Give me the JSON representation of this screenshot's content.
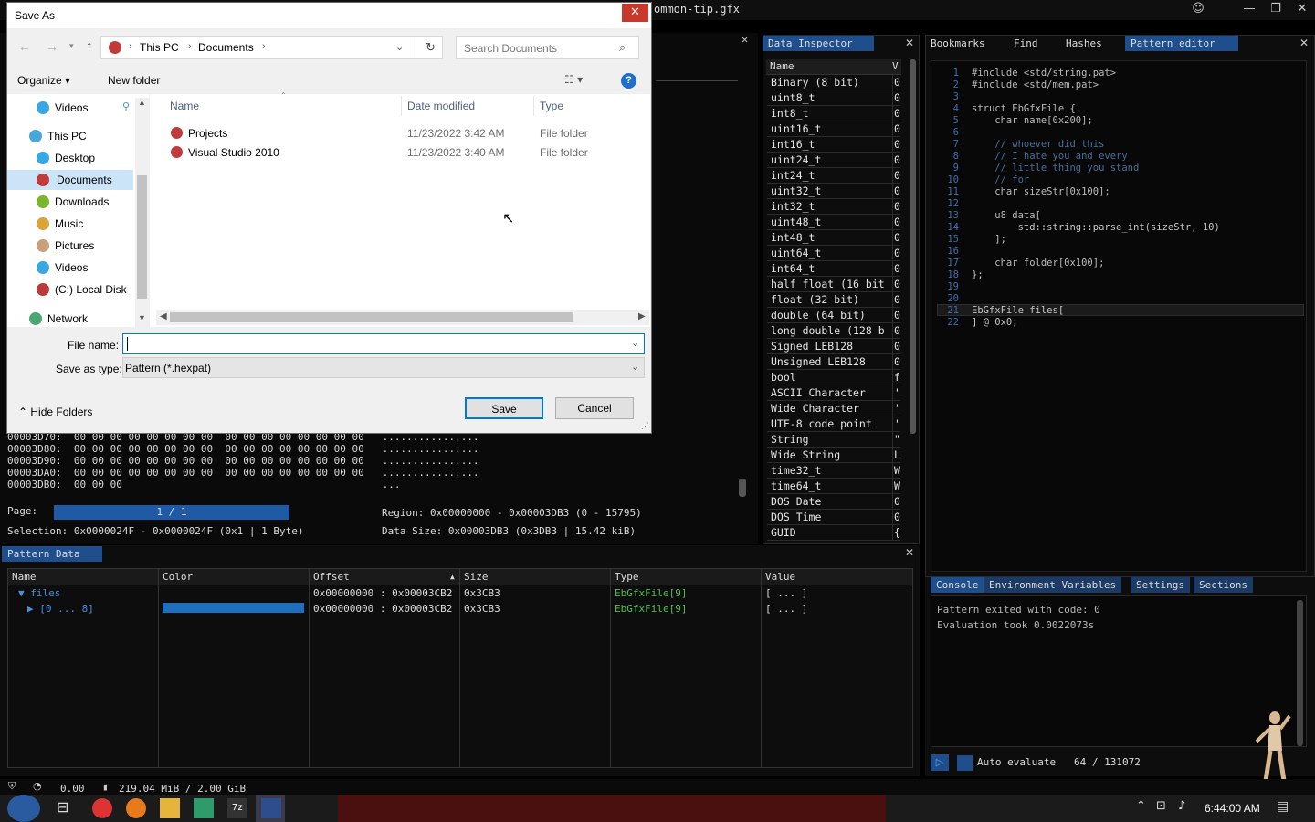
{
  "app": {
    "window_title": "ommon-tip.gfx",
    "colors": {
      "accent": "#1f4e8c",
      "bg": "#0d0d0d",
      "highlight_blue": "#2266c0"
    }
  },
  "data_inspector": {
    "tab": "Data Inspector",
    "col_name": "Name",
    "col_value": "V",
    "rows": [
      {
        "name": "Binary (8 bit)",
        "value": "0"
      },
      {
        "name": "uint8_t",
        "value": "0"
      },
      {
        "name": "int8_t",
        "value": "0"
      },
      {
        "name": "uint16_t",
        "value": "0"
      },
      {
        "name": "int16_t",
        "value": "0"
      },
      {
        "name": "uint24_t",
        "value": "0"
      },
      {
        "name": "int24_t",
        "value": "0"
      },
      {
        "name": "uint32_t",
        "value": "0"
      },
      {
        "name": "int32_t",
        "value": "0"
      },
      {
        "name": "uint48_t",
        "value": "0"
      },
      {
        "name": "int48_t",
        "value": "0"
      },
      {
        "name": "uint64_t",
        "value": "0"
      },
      {
        "name": "int64_t",
        "value": "0"
      },
      {
        "name": "half float (16 bit",
        "value": "0"
      },
      {
        "name": "float (32 bit)",
        "value": "0"
      },
      {
        "name": "double (64 bit)",
        "value": "0"
      },
      {
        "name": "long double (128 b",
        "value": "0"
      },
      {
        "name": "Signed LEB128",
        "value": "0"
      },
      {
        "name": "Unsigned LEB128",
        "value": "0"
      },
      {
        "name": "bool",
        "value": "f"
      },
      {
        "name": "ASCII Character",
        "value": "'"
      },
      {
        "name": "Wide Character",
        "value": "'"
      },
      {
        "name": "UTF-8 code point",
        "value": "'"
      },
      {
        "name": "String",
        "value": "\""
      },
      {
        "name": "Wide String",
        "value": "L"
      },
      {
        "name": "time32_t",
        "value": "W"
      },
      {
        "name": "time64_t",
        "value": "W"
      },
      {
        "name": "DOS Date",
        "value": "0"
      },
      {
        "name": "DOS Time",
        "value": "0"
      },
      {
        "name": "GUID",
        "value": "{"
      }
    ]
  },
  "right_tabs": [
    "Bookmarks",
    "Find",
    "Hashes",
    "Pattern editor"
  ],
  "pattern_editor": {
    "lines": [
      {
        "n": "1",
        "t": "#include <std/string.pat>"
      },
      {
        "n": "2",
        "t": "#include <std/mem.pat>"
      },
      {
        "n": "3",
        "t": ""
      },
      {
        "n": "4",
        "t": "struct EbGfxFile {"
      },
      {
        "n": "5",
        "t": "    char name[0x200];"
      },
      {
        "n": "6",
        "t": ""
      },
      {
        "n": "7",
        "t": "    // whoever did this"
      },
      {
        "n": "8",
        "t": "    // I hate you and every"
      },
      {
        "n": "9",
        "t": "    // little thing you stand"
      },
      {
        "n": "10",
        "t": "    // for"
      },
      {
        "n": "11",
        "t": "    char sizeStr[0x100];"
      },
      {
        "n": "12",
        "t": ""
      },
      {
        "n": "13",
        "t": "    u8 data["
      },
      {
        "n": "14",
        "t": "        std::string::parse_int(sizeStr, 10)"
      },
      {
        "n": "15",
        "t": "    ];"
      },
      {
        "n": "16",
        "t": ""
      },
      {
        "n": "17",
        "t": "    char folder[0x100];"
      },
      {
        "n": "18",
        "t": "};"
      },
      {
        "n": "19",
        "t": ""
      },
      {
        "n": "20",
        "t": ""
      },
      {
        "n": "21",
        "t": "EbGfxFile files["
      },
      {
        "n": "22",
        "t": "] @ 0x0;"
      }
    ]
  },
  "hex_view": {
    "rows": [
      "00003D70:  00 00 00 00 00 00 00 00  00 00 00 00 00 00 00 00   ................",
      "00003D80:  00 00 00 00 00 00 00 00  00 00 00 00 00 00 00 00   ................",
      "00003D90:  00 00 00 00 00 00 00 00  00 00 00 00 00 00 00 00   ................",
      "00003DA0:  00 00 00 00 00 00 00 00  00 00 00 00 00 00 00 00   ................",
      "00003DB0:  00 00 00                                           ..."
    ],
    "page_label": "Page:",
    "page_value": "1 / 1",
    "region": "Region: 0x00000000 - 0x00003DB3 (0 - 15795)",
    "selection": "Selection: 0x0000024F - 0x0000024F (0x1 | 1 Byte)",
    "data_size": "Data Size: 0x00003DB3 (0x3DB3 | 15.42 kiB)"
  },
  "pattern_data": {
    "tab": "Pattern Data",
    "headers": {
      "name": "Name",
      "color": "Color",
      "offset": "Offset",
      "size": "Size",
      "type": "Type",
      "value": "Value"
    },
    "rows": [
      {
        "name": "files",
        "offset": "0x00000000 : 0x00003CB2",
        "size": "0x3CB3",
        "type": "EbGfxFile[9]",
        "value": "[ ... ]"
      },
      {
        "name": "[0 ... 8]",
        "offset": "0x00000000 : 0x00003CB2",
        "size": "0x3CB3",
        "type": "EbGfxFile[9]",
        "value": "[ ... ]"
      }
    ]
  },
  "console": {
    "tabs": [
      "Console",
      "Environment Variables",
      "Settings",
      "Sections"
    ],
    "lines": [
      "Pattern exited with code: 0",
      "Evaluation took 0.0022073s"
    ],
    "auto_evaluate": "Auto evaluate",
    "counter": "64 / 131072"
  },
  "statusbar": {
    "fps": "0.00",
    "memory": "219.04 MiB / 2.00 GiB"
  },
  "save_dialog": {
    "title": "Save As",
    "breadcrumb": [
      "This PC",
      "Documents"
    ],
    "search_placeholder": "Search Documents",
    "organize": "Organize",
    "new_folder": "New folder",
    "nav_items": [
      {
        "label": "Videos",
        "icon": "videos-icon"
      },
      {
        "label": "This PC",
        "icon": "pc-icon"
      },
      {
        "label": "Desktop",
        "icon": "desktop-icon"
      },
      {
        "label": "Documents",
        "icon": "documents-icon"
      },
      {
        "label": "Downloads",
        "icon": "downloads-icon"
      },
      {
        "label": "Music",
        "icon": "music-icon"
      },
      {
        "label": "Pictures",
        "icon": "pictures-icon"
      },
      {
        "label": "Videos",
        "icon": "videos-icon"
      },
      {
        "label": "(C:) Local Disk",
        "icon": "disk-icon"
      },
      {
        "label": "Network",
        "icon": "network-icon"
      }
    ],
    "columns": {
      "name": "Name",
      "date": "Date modified",
      "type": "Type"
    },
    "files": [
      {
        "name": "Projects",
        "date": "11/23/2022 3:42 AM",
        "type": "File folder"
      },
      {
        "name": "Visual Studio 2010",
        "date": "11/23/2022 3:40 AM",
        "type": "File folder"
      }
    ],
    "file_name_label": "File name:",
    "file_name_value": "",
    "save_type_label": "Save as type:",
    "save_type_value": "Pattern (*.hexpat)",
    "hide_folders": "Hide Folders",
    "save": "Save",
    "cancel": "Cancel"
  },
  "taskbar": {
    "time": "6:44:00 AM"
  }
}
